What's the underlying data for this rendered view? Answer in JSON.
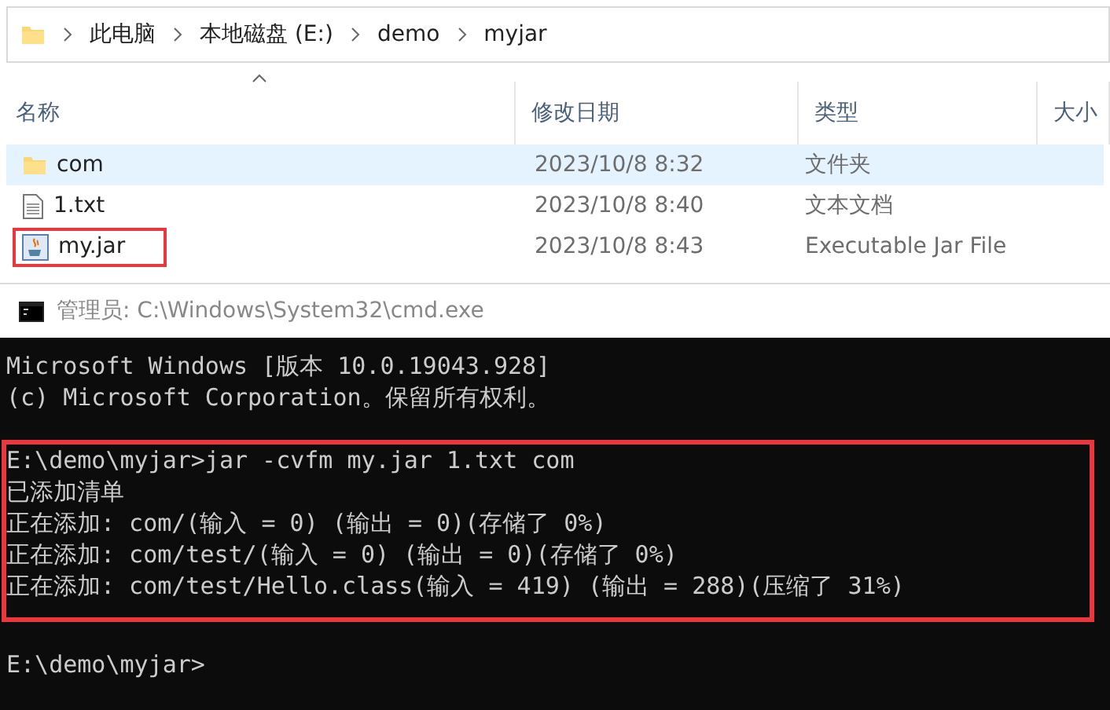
{
  "breadcrumb": [
    "此电脑",
    "本地磁盘 (E:)",
    "demo",
    "myjar"
  ],
  "columns": [
    "名称",
    "修改日期",
    "类型",
    "大小"
  ],
  "files": [
    {
      "kind": "folder",
      "name": "com",
      "date": "2023/10/8 8:32",
      "type": "文件夹",
      "selected": true,
      "boxed": false
    },
    {
      "kind": "text",
      "name": "1.txt",
      "date": "2023/10/8 8:40",
      "type": "文本文档",
      "selected": false,
      "boxed": false
    },
    {
      "kind": "jar",
      "name": "my.jar",
      "date": "2023/10/8 8:43",
      "type": "Executable Jar File",
      "selected": false,
      "boxed": true
    }
  ],
  "console": {
    "title": "管理员: C:\\Windows\\System32\\cmd.exe",
    "blocks": [
      {
        "boxed": false,
        "lines": [
          "Microsoft Windows [版本 10.0.19043.928]",
          "(c) Microsoft Corporation。保留所有权利。"
        ]
      },
      {
        "boxed": true,
        "lines": [
          "E:\\demo\\myjar>jar -cvfm my.jar 1.txt com",
          "已添加清单",
          "正在添加: com/(输入 = 0) (输出 = 0)(存储了 0%)",
          "正在添加: com/test/(输入 = 0) (输出 = 0)(存储了 0%)",
          "正在添加: com/test/Hello.class(输入 = 419) (输出 = 288)(压缩了 31%)"
        ]
      },
      {
        "boxed": false,
        "lines": [
          "E:\\demo\\myjar>"
        ]
      }
    ]
  }
}
